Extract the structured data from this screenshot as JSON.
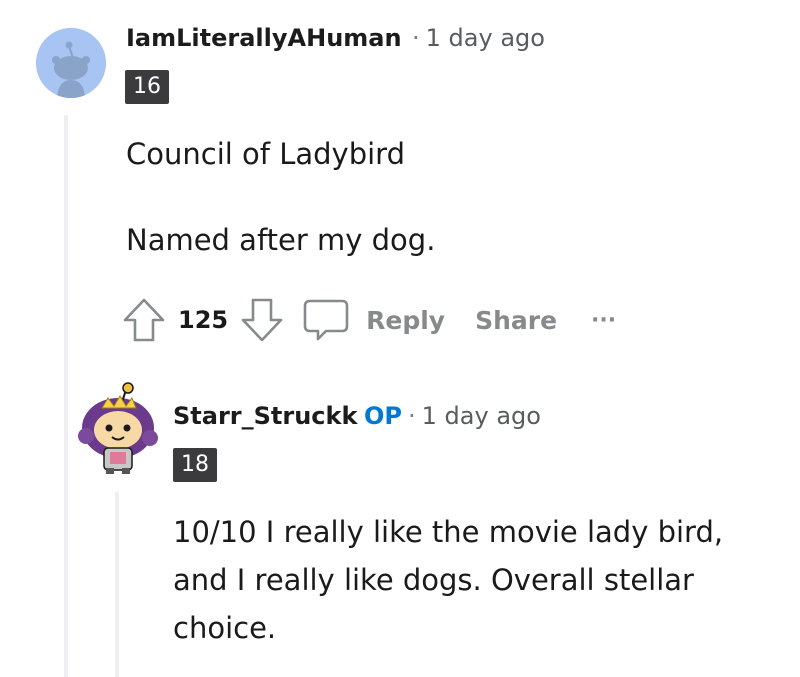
{
  "comment1": {
    "username": "IamLiterallyAHuman",
    "separator": "·",
    "time": "1 day ago",
    "flair": "16",
    "body": [
      "Council of Ladybird",
      "Named after my dog."
    ],
    "votes": "125",
    "reply_label": "Reply",
    "share_label": "Share",
    "more_label": "···"
  },
  "comment2": {
    "username": "Starr_Struckk",
    "op_tag": "OP",
    "separator": "·",
    "time": "1 day ago",
    "flair": "18",
    "body": "10/10 I really like the movie lady bird, and I really like dogs. Overall stellar choice."
  },
  "colors": {
    "upvote": "#878a8c",
    "op": "#0079d3",
    "thread_line": "#edeff1",
    "avatar_bg": "#a8c4f2"
  }
}
